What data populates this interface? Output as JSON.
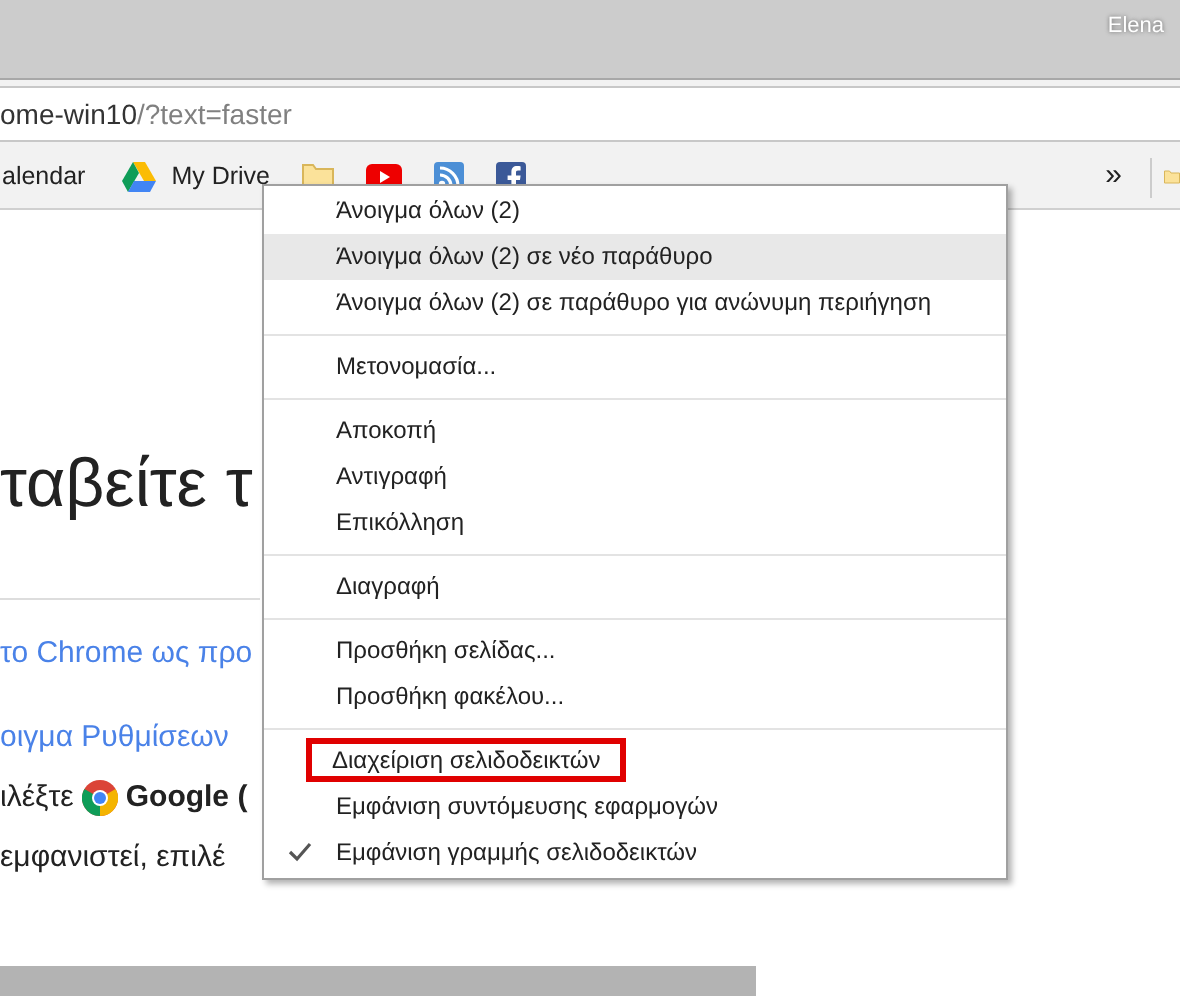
{
  "window": {
    "user": "Elena"
  },
  "address_bar": {
    "host": "ome-win10",
    "path": "/?text=faster"
  },
  "bookmarks": [
    {
      "kind": "text",
      "label": "alendar"
    },
    {
      "kind": "drive",
      "label": "My Drive"
    },
    {
      "kind": "folder"
    },
    {
      "kind": "youtube"
    },
    {
      "kind": "rss"
    },
    {
      "kind": "facebook"
    }
  ],
  "bookmarks_overflow": "»",
  "page": {
    "heading": "ταβείτε τ",
    "lines": [
      {
        "kind": "link",
        "text": "το Chrome ως προ"
      },
      {
        "kind": "link",
        "text": "οιγμα Ρυθμίσεων"
      },
      {
        "kind": "chrome",
        "text": "ιλέξτε",
        "bold": "Google ("
      },
      {
        "kind": "plain",
        "text": "εμφανιστεί, επιλέ"
      }
    ]
  },
  "menu": {
    "groups": [
      [
        {
          "label": "Άνοιγμα όλων (2)",
          "selected": false
        },
        {
          "label": "Άνοιγμα όλων (2) σε νέο παράθυρο",
          "selected": true
        },
        {
          "label": "Άνοιγμα όλων (2) σε παράθυρο για ανώνυμη περιήγηση",
          "selected": false
        }
      ],
      [
        {
          "label": "Μετονομασία...",
          "selected": false
        }
      ],
      [
        {
          "label": "Αποκοπή",
          "selected": false
        },
        {
          "label": "Αντιγραφή",
          "selected": false
        },
        {
          "label": "Επικόλληση",
          "selected": false
        }
      ],
      [
        {
          "label": "Διαγραφή",
          "selected": false
        }
      ],
      [
        {
          "label": "Προσθήκη σελίδας...",
          "selected": false
        },
        {
          "label": "Προσθήκη φακέλου...",
          "selected": false
        }
      ],
      [
        {
          "label": "Διαχείριση σελιδοδεικτών",
          "selected": false,
          "outlined": true
        },
        {
          "label": "Εμφάνιση συντόμευσης εφαρμογών",
          "selected": false,
          "checked": false
        },
        {
          "label": "Εμφάνιση γραμμής σελιδοδεικτών",
          "selected": false,
          "checked": true
        }
      ]
    ]
  }
}
